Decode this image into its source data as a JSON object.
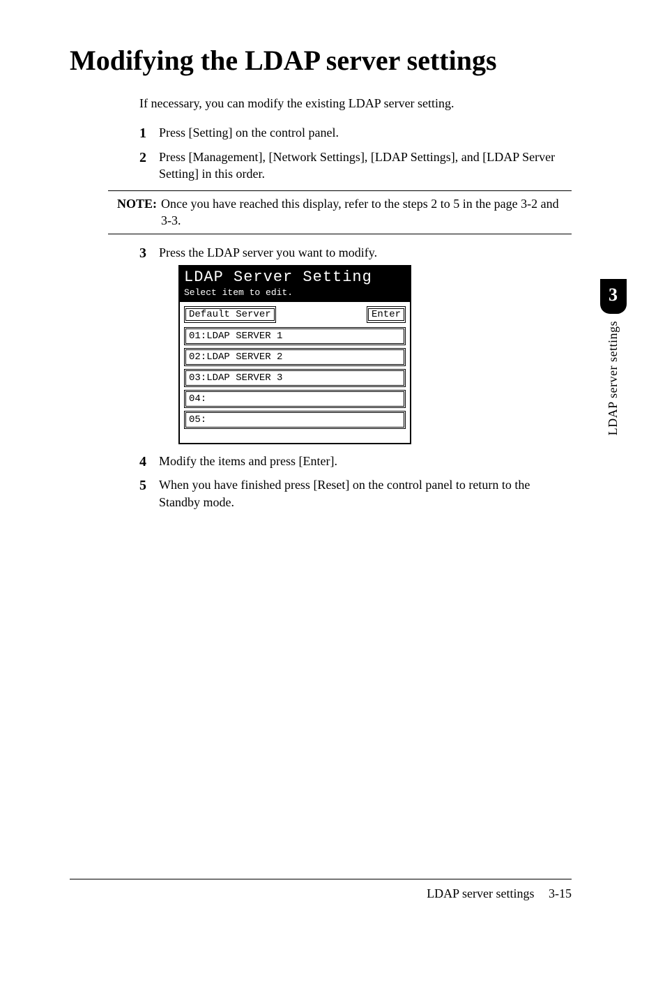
{
  "title": "Modifying the LDAP server settings",
  "intro": "If necessary, you can modify the existing LDAP server setting.",
  "steps": {
    "s1": {
      "num": "1",
      "text": "Press [Setting] on the control panel."
    },
    "s2": {
      "num": "2",
      "text": "Press [Management], [Network Settings], [LDAP Settings], and [LDAP Server Setting] in this order."
    },
    "s3": {
      "num": "3",
      "text": "Press the LDAP server you want to modify."
    },
    "s4": {
      "num": "4",
      "text": "Modify the items and press [Enter]."
    },
    "s5": {
      "num": "5",
      "text": "When you have finished press [Reset] on the control panel to return to the Standby mode."
    }
  },
  "note": {
    "label": "NOTE:",
    "text": "Once you have reached this display, refer to the steps 2 to 5 in the page 3-2 and 3-3."
  },
  "screen": {
    "title": "LDAP Server Setting",
    "subtitle": "Select item to edit.",
    "default_server_btn": "Default Server",
    "enter_btn": "Enter",
    "items": [
      "01:LDAP SERVER 1",
      "02:LDAP SERVER 2",
      "03:LDAP SERVER 3",
      "04:",
      "05:"
    ]
  },
  "side_tab": {
    "num": "3",
    "text": "LDAP server settings"
  },
  "footer": {
    "section": "LDAP server settings",
    "page": "3-15"
  }
}
